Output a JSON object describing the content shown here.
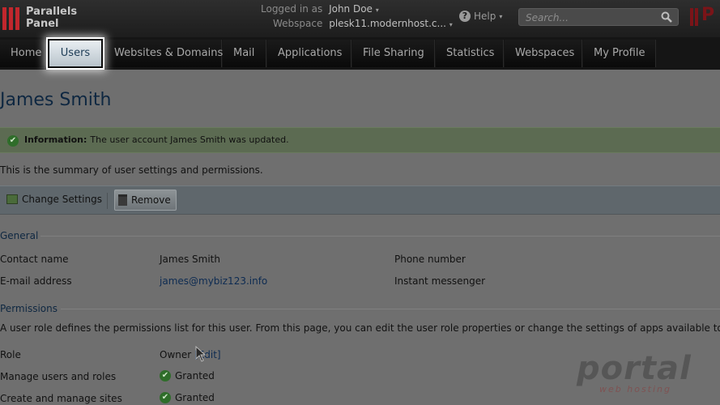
{
  "header": {
    "logo_line1": "Parallels",
    "logo_line2": "Panel",
    "logged_in_label": "Logged in as",
    "logged_in_user": "John Doe",
    "webspace_label": "Webspace",
    "webspace_value": "plesk11.modernhost.c...",
    "help_label": "Help",
    "search_placeholder": "Search..."
  },
  "nav": {
    "tabs": [
      {
        "label": "Home"
      },
      {
        "label": "Users"
      },
      {
        "label": "Websites & Domains"
      },
      {
        "label": "Mail"
      },
      {
        "label": "Applications"
      },
      {
        "label": "File Sharing"
      },
      {
        "label": "Statistics"
      },
      {
        "label": "Webspaces"
      },
      {
        "label": "My Profile"
      }
    ]
  },
  "page": {
    "title": "James Smith",
    "info_label": "Information:",
    "info_text": "The user account James Smith was updated.",
    "summary": "This is the summary of user settings and permissions.",
    "toolbar": {
      "change_settings": "Change Settings",
      "remove": "Remove"
    },
    "general": {
      "heading": "General",
      "contact_name_label": "Contact name",
      "contact_name_value": "James Smith",
      "phone_label": "Phone number",
      "email_label": "E-mail address",
      "email_value": "james@mybiz123.info",
      "messenger_label": "Instant messenger"
    },
    "permissions": {
      "heading": "Permissions",
      "description": "A user role defines the permissions list for this user. From this page, you can edit the user role properties or change the settings of apps available to the",
      "role_label": "Role",
      "role_value": "Owner",
      "role_edit": "[Edit]",
      "rows": [
        {
          "label": "Manage users and roles",
          "value": "Granted"
        },
        {
          "label": "Create and manage sites",
          "value": "Granted"
        }
      ]
    }
  },
  "watermark": {
    "big": "portal",
    "small": "web hosting"
  }
}
